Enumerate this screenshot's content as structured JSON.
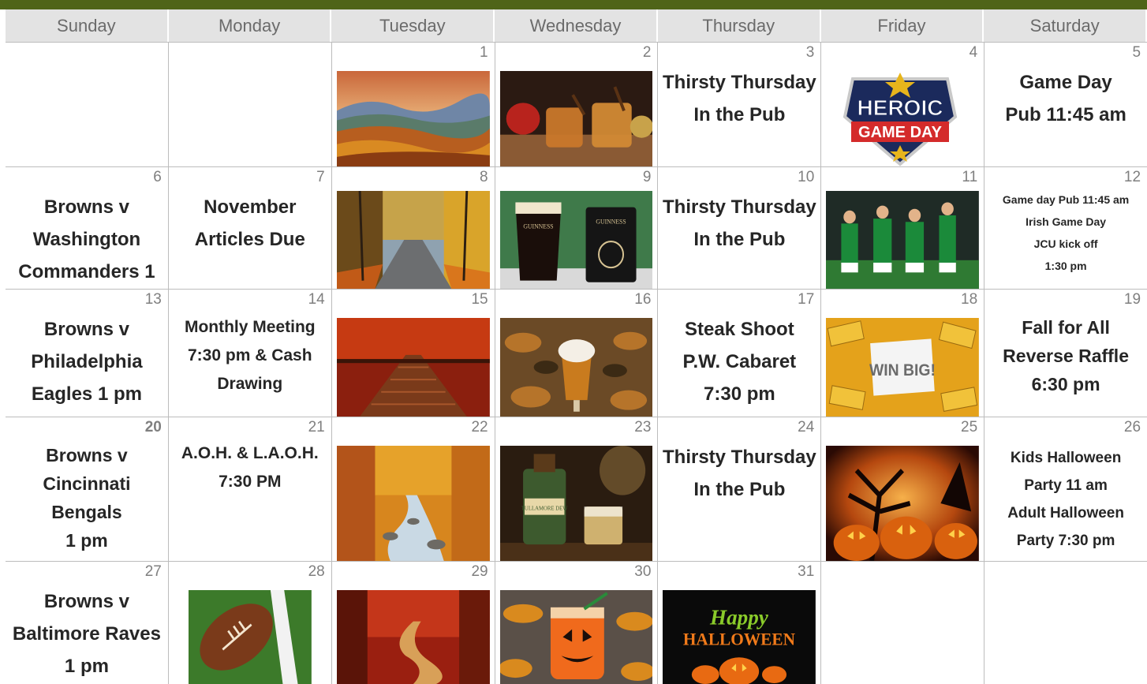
{
  "days": [
    "Sunday",
    "Monday",
    "Tuesday",
    "Wednesday",
    "Thursday",
    "Friday",
    "Saturday"
  ],
  "cells": {
    "d1": "1",
    "d2": "2",
    "d3": "3",
    "d4": "4",
    "d5": "5",
    "d6": "6",
    "d7": "7",
    "d8": "8",
    "d9": "9",
    "d10": "10",
    "d11": "11",
    "d12": "12",
    "d13": "13",
    "d14": "14",
    "d15": "15",
    "d16": "16",
    "d17": "17",
    "d18": "18",
    "d19": "19",
    "d20": "20",
    "d21": "21",
    "d22": "22",
    "d23": "23",
    "d24": "24",
    "d25": "25",
    "d26": "26",
    "d27": "27",
    "d28": "28",
    "d29": "29",
    "d30": "30",
    "d31": "31"
  },
  "events": {
    "e3": [
      "Thirsty Thursday",
      "In the Pub"
    ],
    "e5": [
      "Game Day",
      "Pub 11:45 am"
    ],
    "e6": [
      "Browns v",
      "Washington",
      "Commanders 1 pm"
    ],
    "e7": [
      "November",
      "Articles Due"
    ],
    "e10": [
      "Thirsty Thursday",
      "In the Pub"
    ],
    "e12": [
      "Game day Pub 11:45 am",
      "Irish Game Day",
      "JCU kick off",
      "1:30 pm"
    ],
    "e13": [
      "Browns v",
      "Philadelphia",
      "Eagles 1 pm"
    ],
    "e14": [
      "Monthly Meeting",
      "7:30 pm & Cash",
      "Drawing"
    ],
    "e17": [
      "Steak Shoot",
      "P.W. Cabaret",
      "7:30 pm"
    ],
    "e19": [
      "Fall for All",
      "Reverse Raffle",
      "6:30 pm"
    ],
    "e20": [
      "Browns v",
      "Cincinnati Bengals",
      "1 pm"
    ],
    "e21": [
      "A.O.H. & L.A.O.H.",
      "7:30 PM"
    ],
    "e24": [
      "Thirsty Thursday",
      "In the Pub"
    ],
    "e26": [
      "Kids Halloween",
      "Party 11 am",
      "Adult Halloween",
      "Party 7:30 pm"
    ],
    "e27": [
      "Browns v",
      "Baltimore Raves",
      "1 pm"
    ]
  },
  "image_text": {
    "heroic_top": "HEROIC",
    "heroic_bottom": "GAME DAY",
    "raffle": "WIN BIG!",
    "guinness": "GUINNESS",
    "halloween1": "Happy",
    "halloween2": "HALLOWEEN",
    "tullamore": "TULLAMORE DEW"
  },
  "colors": {
    "topbar": "#4f6418",
    "header_bg": "#e3e3e3",
    "header_text": "#6b6b6b",
    "event_text": "#262626"
  }
}
